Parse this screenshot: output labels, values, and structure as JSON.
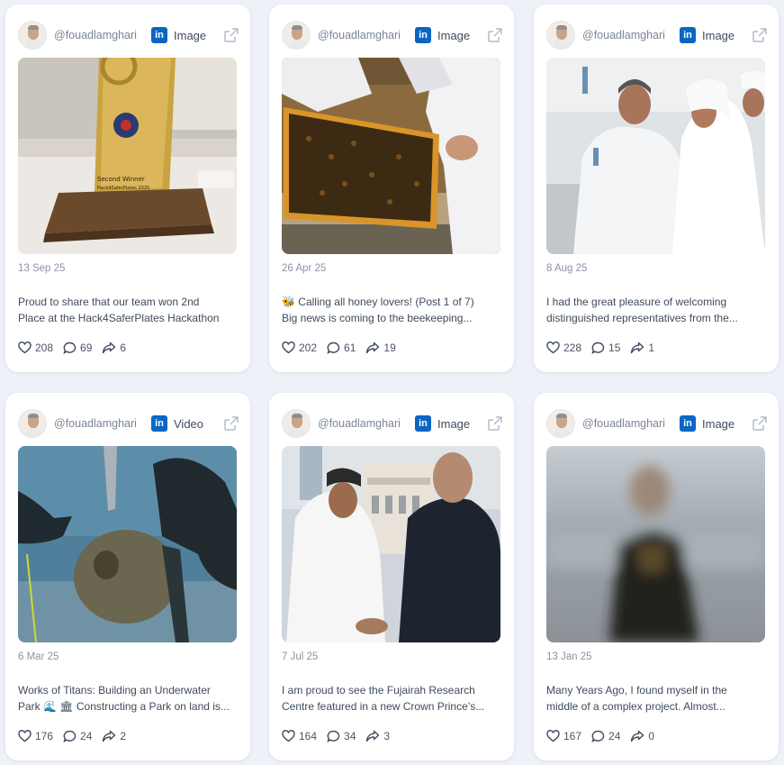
{
  "posts": [
    {
      "handle": "@fouadlamghari",
      "network": "in",
      "type": "Image",
      "date": "13 Sep 25",
      "text_line1": "Proud to share that our team won 2nd",
      "text_line2": "Place at the Hack4SaferPlates Hackathon",
      "likes": "208",
      "comments": "69",
      "shares": "6",
      "media_desc": "trophy",
      "media_text1": "Second Winner",
      "media_text2": "Hack4SaferPlates 2025"
    },
    {
      "handle": "@fouadlamghari",
      "network": "in",
      "type": "Image",
      "date": "26 Apr 25",
      "text_line1": "🐝 Calling all honey lovers!  (Post 1 of 7)",
      "text_line2": "Big news is coming to the beekeeping...",
      "likes": "202",
      "comments": "61",
      "shares": "19",
      "media_desc": "beehive-frame"
    },
    {
      "handle": "@fouadlamghari",
      "network": "in",
      "type": "Image",
      "date": "8 Aug 25",
      "text_line1": "I had the great pleasure of welcoming",
      "text_line2": "distinguished representatives from the...",
      "likes": "228",
      "comments": "15",
      "shares": "1",
      "media_desc": "lab-visit"
    },
    {
      "handle": "@fouadlamghari",
      "network": "in",
      "type": "Video",
      "date": "6 Mar 25",
      "text_line1": "Works of Titans: Building an Underwater",
      "text_line2": "Park 🌊 🏛 Constructing a Park on land is...",
      "likes": "176",
      "comments": "24",
      "shares": "2",
      "media_desc": "divers"
    },
    {
      "handle": "@fouadlamghari",
      "network": "in",
      "type": "Image",
      "date": "7 Jul 25",
      "text_line1": "I am proud to see the Fujairah Research",
      "text_line2": "Centre featured in a new Crown Prince’s...",
      "likes": "164",
      "comments": "34",
      "shares": "3",
      "media_desc": "handshake"
    },
    {
      "handle": "@fouadlamghari",
      "network": "in",
      "type": "Image",
      "date": "13 Jan 25",
      "text_line1": "Many Years Ago, I found myself in the",
      "text_line2": "middle of a complex project. Almost...",
      "likes": "167",
      "comments": "24",
      "shares": "0",
      "media_desc": "blurred-person"
    }
  ],
  "colors": {
    "background": "#eef2f8",
    "card": "#ffffff",
    "linkedin": "#0a66c2",
    "icon": "#3e4b5c"
  },
  "icons": {
    "like": "heart-icon",
    "comment": "comment-icon",
    "share": "share-icon",
    "external": "external-link-icon",
    "network": "linkedin-icon"
  }
}
